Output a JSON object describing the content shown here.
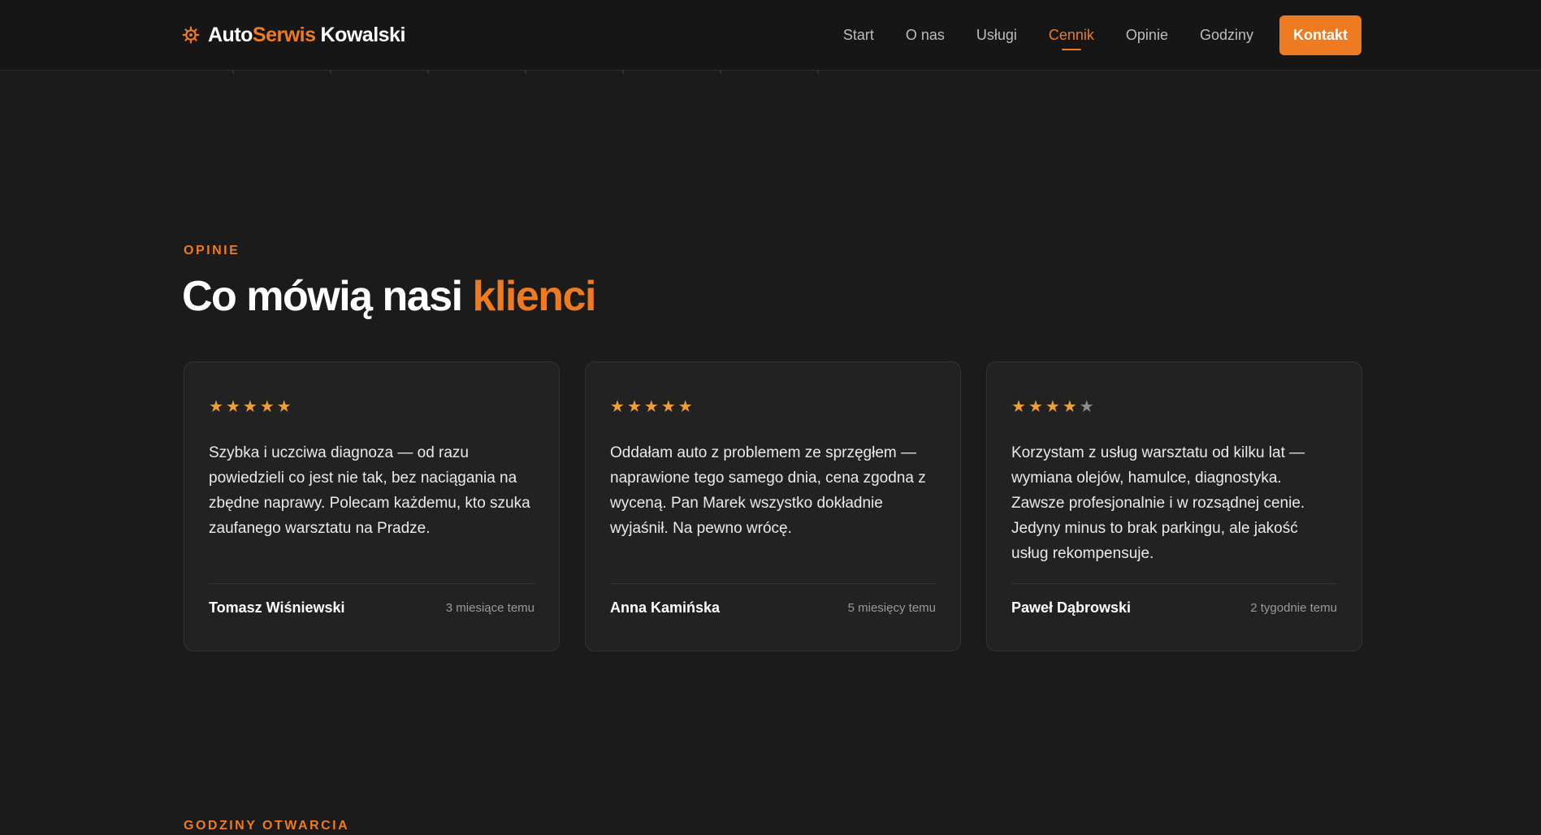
{
  "header": {
    "logo": {
      "part1": "Auto",
      "part2": "Serwis",
      "part3": "Kowalski",
      "icon": "gear-icon"
    },
    "nav": [
      {
        "label": "Start",
        "active": false
      },
      {
        "label": "O nas",
        "active": false
      },
      {
        "label": "Usługi",
        "active": false
      },
      {
        "label": "Cennik",
        "active": true
      },
      {
        "label": "Opinie",
        "active": false
      },
      {
        "label": "Godziny",
        "active": false
      }
    ],
    "cta_label": "Kontakt"
  },
  "opinions": {
    "eyebrow": "OPINIE",
    "title_main": "Co mówią nasi",
    "title_accent": "klienci",
    "reviews": [
      {
        "rating": 5,
        "text": "Szybka i uczciwa diagnoza — od razu powiedzieli co jest nie tak, bez naciągania na zbędne naprawy. Polecam każdemu, kto szuka zaufanego warsztatu na Pradze.",
        "author": "Tomasz Wiśniewski",
        "time": "3 miesiące temu"
      },
      {
        "rating": 5,
        "text": "Oddałam auto z problemem ze sprzęgłem — naprawione tego samego dnia, cena zgodna z wyceną. Pan Marek wszystko dokładnie wyjaśnił. Na pewno wrócę.",
        "author": "Anna Kamińska",
        "time": "5 miesięcy temu"
      },
      {
        "rating": 4,
        "text": "Korzystam z usług warsztatu od kilku lat — wymiana olejów, hamulce, diagnostyka. Zawsze profesjonalnie i w rozsądnej cenie. Jedyny minus to brak parkingu, ale jakość usług rekompensuje.",
        "author": "Paweł Dąbrowski",
        "time": "2 tygodnie temu"
      }
    ]
  },
  "hours": {
    "eyebrow": "GODZINY OTWARCIA"
  },
  "colors": {
    "accent": "#ee7a22",
    "star": "#f0a032",
    "background": "#1b1b1b",
    "card": "#222222"
  }
}
